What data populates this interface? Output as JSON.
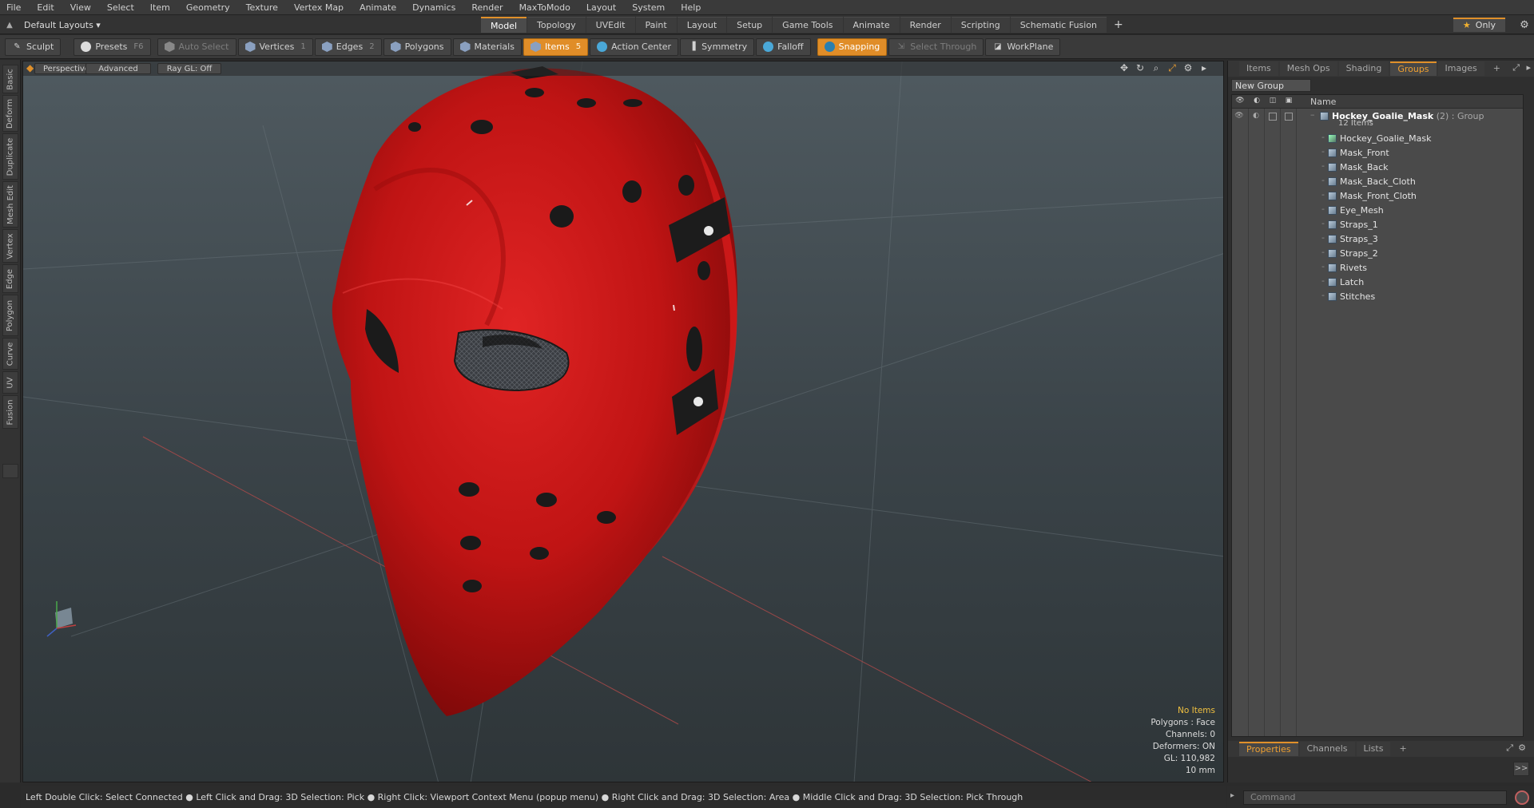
{
  "menu": [
    "File",
    "Edit",
    "View",
    "Select",
    "Item",
    "Geometry",
    "Texture",
    "Vertex Map",
    "Animate",
    "Dynamics",
    "Render",
    "MaxToModo",
    "Layout",
    "System",
    "Help"
  ],
  "layout_dropdown": "Default Layouts ▾",
  "mode_tabs": [
    "Model",
    "Topology",
    "UVEdit",
    "Paint",
    "Layout",
    "Setup",
    "Game Tools",
    "Animate",
    "Render",
    "Scripting",
    "Schematic Fusion"
  ],
  "only_label": "Only",
  "toolbar": {
    "sculpt": "Sculpt",
    "presets": "Presets",
    "presets_key": "F6",
    "auto_select": "Auto Select",
    "vertices": "Vertices",
    "vertices_key": "1",
    "edges": "Edges",
    "edges_key": "2",
    "polygons": "Polygons",
    "materials": "Materials",
    "items": "Items",
    "items_key": "5",
    "action_center": "Action Center",
    "symmetry": "Symmetry",
    "falloff": "Falloff",
    "snapping": "Snapping",
    "select_through": "Select Through",
    "workplane": "WorkPlane"
  },
  "left_tabs": [
    "Basic",
    "Deform",
    "Duplicate",
    "Mesh Edit",
    "Vertex",
    "Edge",
    "Polygon",
    "Curve",
    "UV",
    "Fusion"
  ],
  "viewport": {
    "perspective": "Perspective",
    "advanced": "Advanced",
    "raygl": "Ray GL: Off",
    "info": {
      "no_items": "No Items",
      "polygons": "Polygons : Face",
      "channels": "Channels: 0",
      "deformers": "Deformers: ON",
      "gl": "GL: 110,982",
      "scale": "10 mm"
    }
  },
  "right_panel": {
    "tabs": [
      "Items",
      "Mesh Ops",
      "Shading",
      "Groups",
      "Images"
    ],
    "new_group": "New Group",
    "name_header": "Name",
    "group": {
      "name": "Hockey_Goalie_Mask",
      "meta": "(2) : Group",
      "count": "12 Items"
    },
    "items": [
      "Hockey_Goalie_Mask",
      "Mask_Front",
      "Mask_Back",
      "Mask_Back_Cloth",
      "Mask_Front_Cloth",
      "Eye_Mesh",
      "Straps_1",
      "Straps_3",
      "Straps_2",
      "Rivets",
      "Latch",
      "Stitches"
    ],
    "bottom_tabs": [
      "Properties",
      "Channels",
      "Lists"
    ]
  },
  "statusbar": "Left Double Click: Select Connected ● Left Click and Drag: 3D Selection: Pick ● Right Click: Viewport Context Menu (popup menu) ● Right Click and Drag: 3D Selection: Area ● Middle Click and Drag: 3D Selection: Pick Through",
  "command_placeholder": "Command",
  "colors": {
    "accent": "#e0902a",
    "mask_red": "#c81414",
    "viewport_bg": "#3f484d"
  }
}
